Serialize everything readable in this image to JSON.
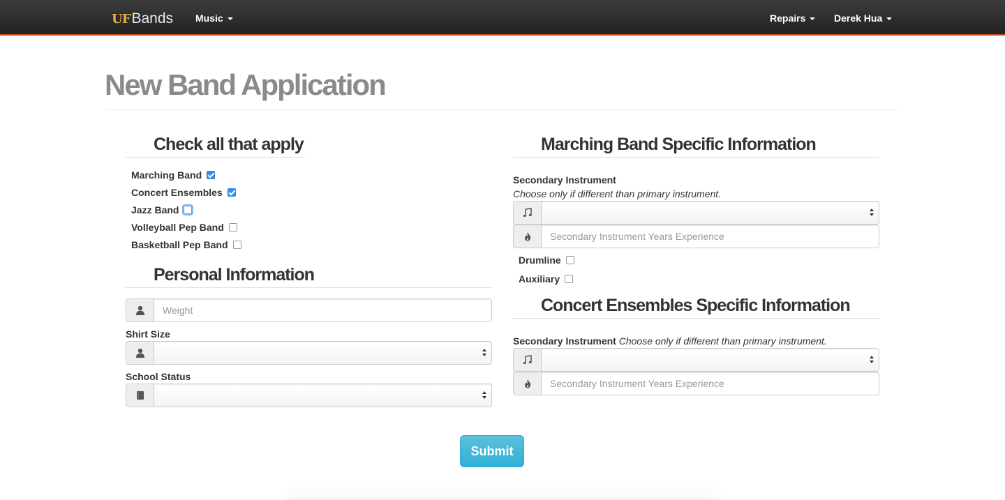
{
  "navbar": {
    "brand_uf": "UF",
    "brand_bands": "Bands",
    "music_label": "Music",
    "repairs_label": "Repairs",
    "user_label": "Derek Hua"
  },
  "page": {
    "title": "New Band Application"
  },
  "check_section": {
    "title": "Check all that apply",
    "items": [
      {
        "label": "Marching Band",
        "checked": true
      },
      {
        "label": "Concert Ensembles",
        "checked": true
      },
      {
        "label": "Jazz Band",
        "checked": false,
        "focused": true
      },
      {
        "label": "Volleyball Pep Band",
        "checked": false
      },
      {
        "label": "Basketball Pep Band",
        "checked": false
      }
    ]
  },
  "personal": {
    "title": "Personal Information",
    "weight_placeholder": "Weight",
    "shirt_size_label": "Shirt Size",
    "shirt_size_value": "",
    "school_status_label": "School Status",
    "school_status_value": ""
  },
  "marching": {
    "title": "Marching Band Specific Information",
    "secondary_label": "Secondary Instrument",
    "secondary_help": "Choose only if different than primary instrument.",
    "secondary_value": "",
    "years_placeholder": "Secondary Instrument Years Experience",
    "drumline_label": "Drumline",
    "auxiliary_label": "Auxiliary"
  },
  "concert": {
    "title": "Concert Ensembles Specific Information",
    "secondary_label": "Secondary Instrument",
    "secondary_help": "Choose only if different than primary instrument.",
    "secondary_value": "",
    "years_placeholder": "Secondary Instrument Years Experience"
  },
  "submit_label": "Submit",
  "icons": {
    "user": "user-icon",
    "book": "book-icon",
    "music": "music-note-icon",
    "fire": "fire-icon"
  },
  "colors": {
    "navbar_accent": "#c8501e",
    "brand_uf": "#e8b04a",
    "checkbox_checked": "#3b8eea",
    "submit": "#31b0d5"
  }
}
